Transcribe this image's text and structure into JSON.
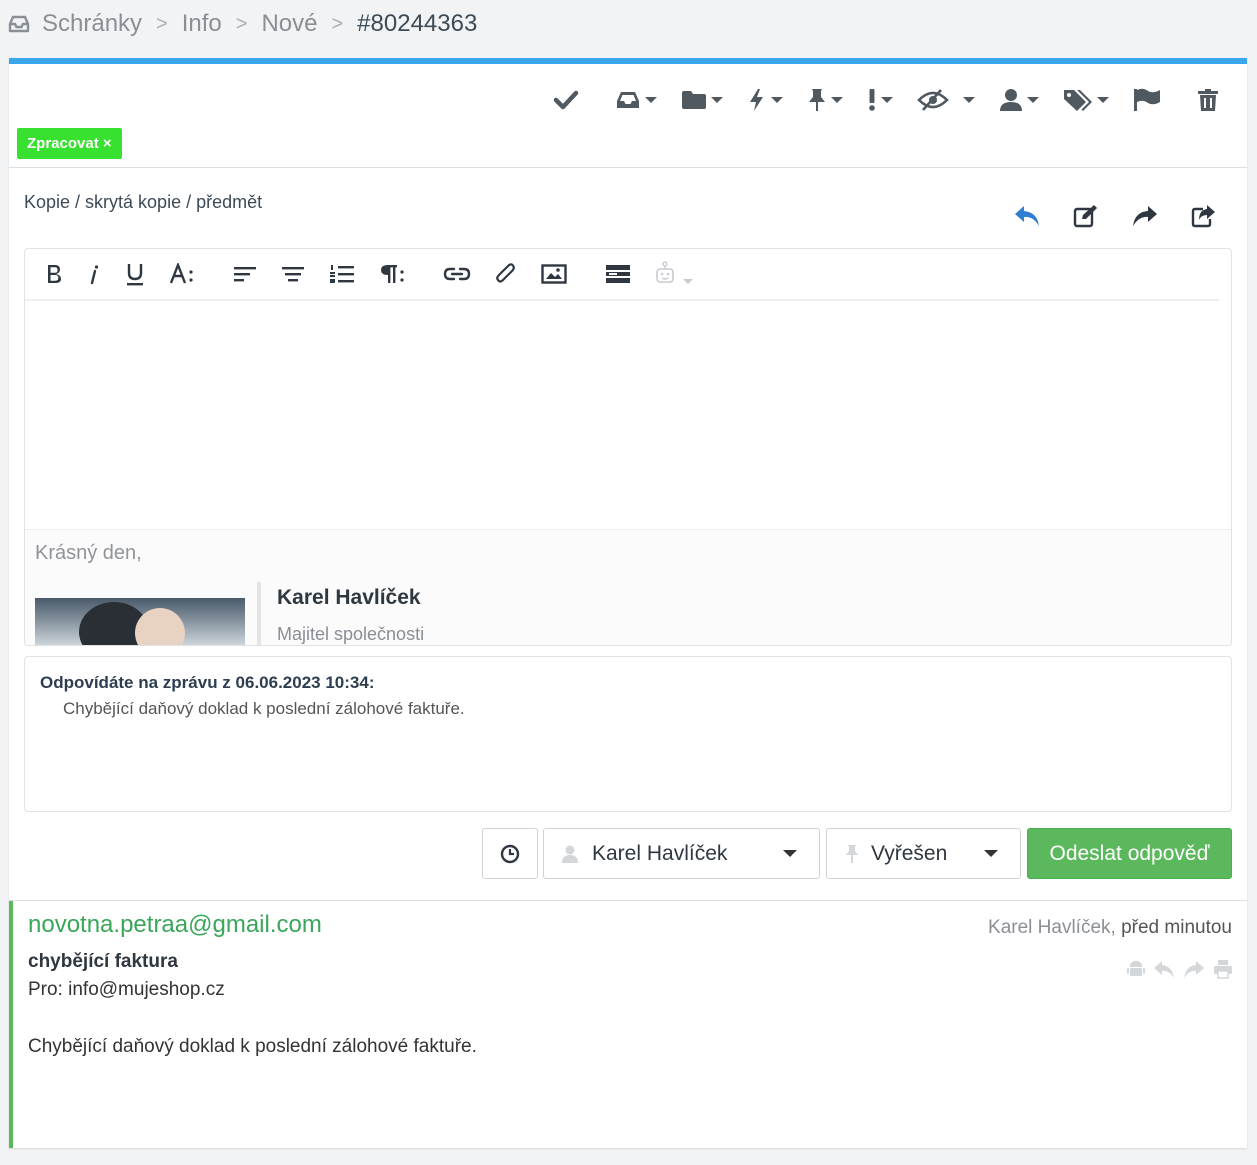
{
  "breadcrumb": {
    "items": [
      "Schránky",
      "Info",
      "Nové"
    ],
    "current": "#80244363",
    "separator": ">"
  },
  "toolbar": {
    "icons": [
      "check-icon",
      "inbox-icon",
      "folder-icon",
      "bolt-icon",
      "pin-icon",
      "exclamation-icon",
      "eye-slash-icon",
      "user-icon",
      "tags-icon",
      "flag-icon",
      "trash-icon"
    ]
  },
  "tag": {
    "label": "Zpracovat ×",
    "color": "#38e12f"
  },
  "compose": {
    "cc_link": "Kopie / skrytá kopie / předmět",
    "signature": {
      "greeting": "Krásný den,",
      "name": "Karel Havlíček",
      "role": "Majitel společnosti"
    }
  },
  "quoted": {
    "heading": "Odpovídáte na zprávu z 06.06.2023 10:34:",
    "text": "Chybějící daňový doklad k poslední zálohové faktuře."
  },
  "actions": {
    "assignee": "Karel Havlíček",
    "status": "Vyřešen",
    "send_label": "Odeslat odpověď"
  },
  "message": {
    "from": "novotna.petraa@gmail.com",
    "author": "Karel Havlíček,",
    "time": "před minutou",
    "subject": "chybějící faktura",
    "to": "Pro: info@mujeshop.cz",
    "body": "Chybějící daňový doklad k poslední zálohové faktuře."
  },
  "colors": {
    "accent": "#3aa6ea",
    "send_button": "#5cb85c",
    "from_link": "#3aa65a",
    "reply_icon": "#2f7fd0"
  }
}
